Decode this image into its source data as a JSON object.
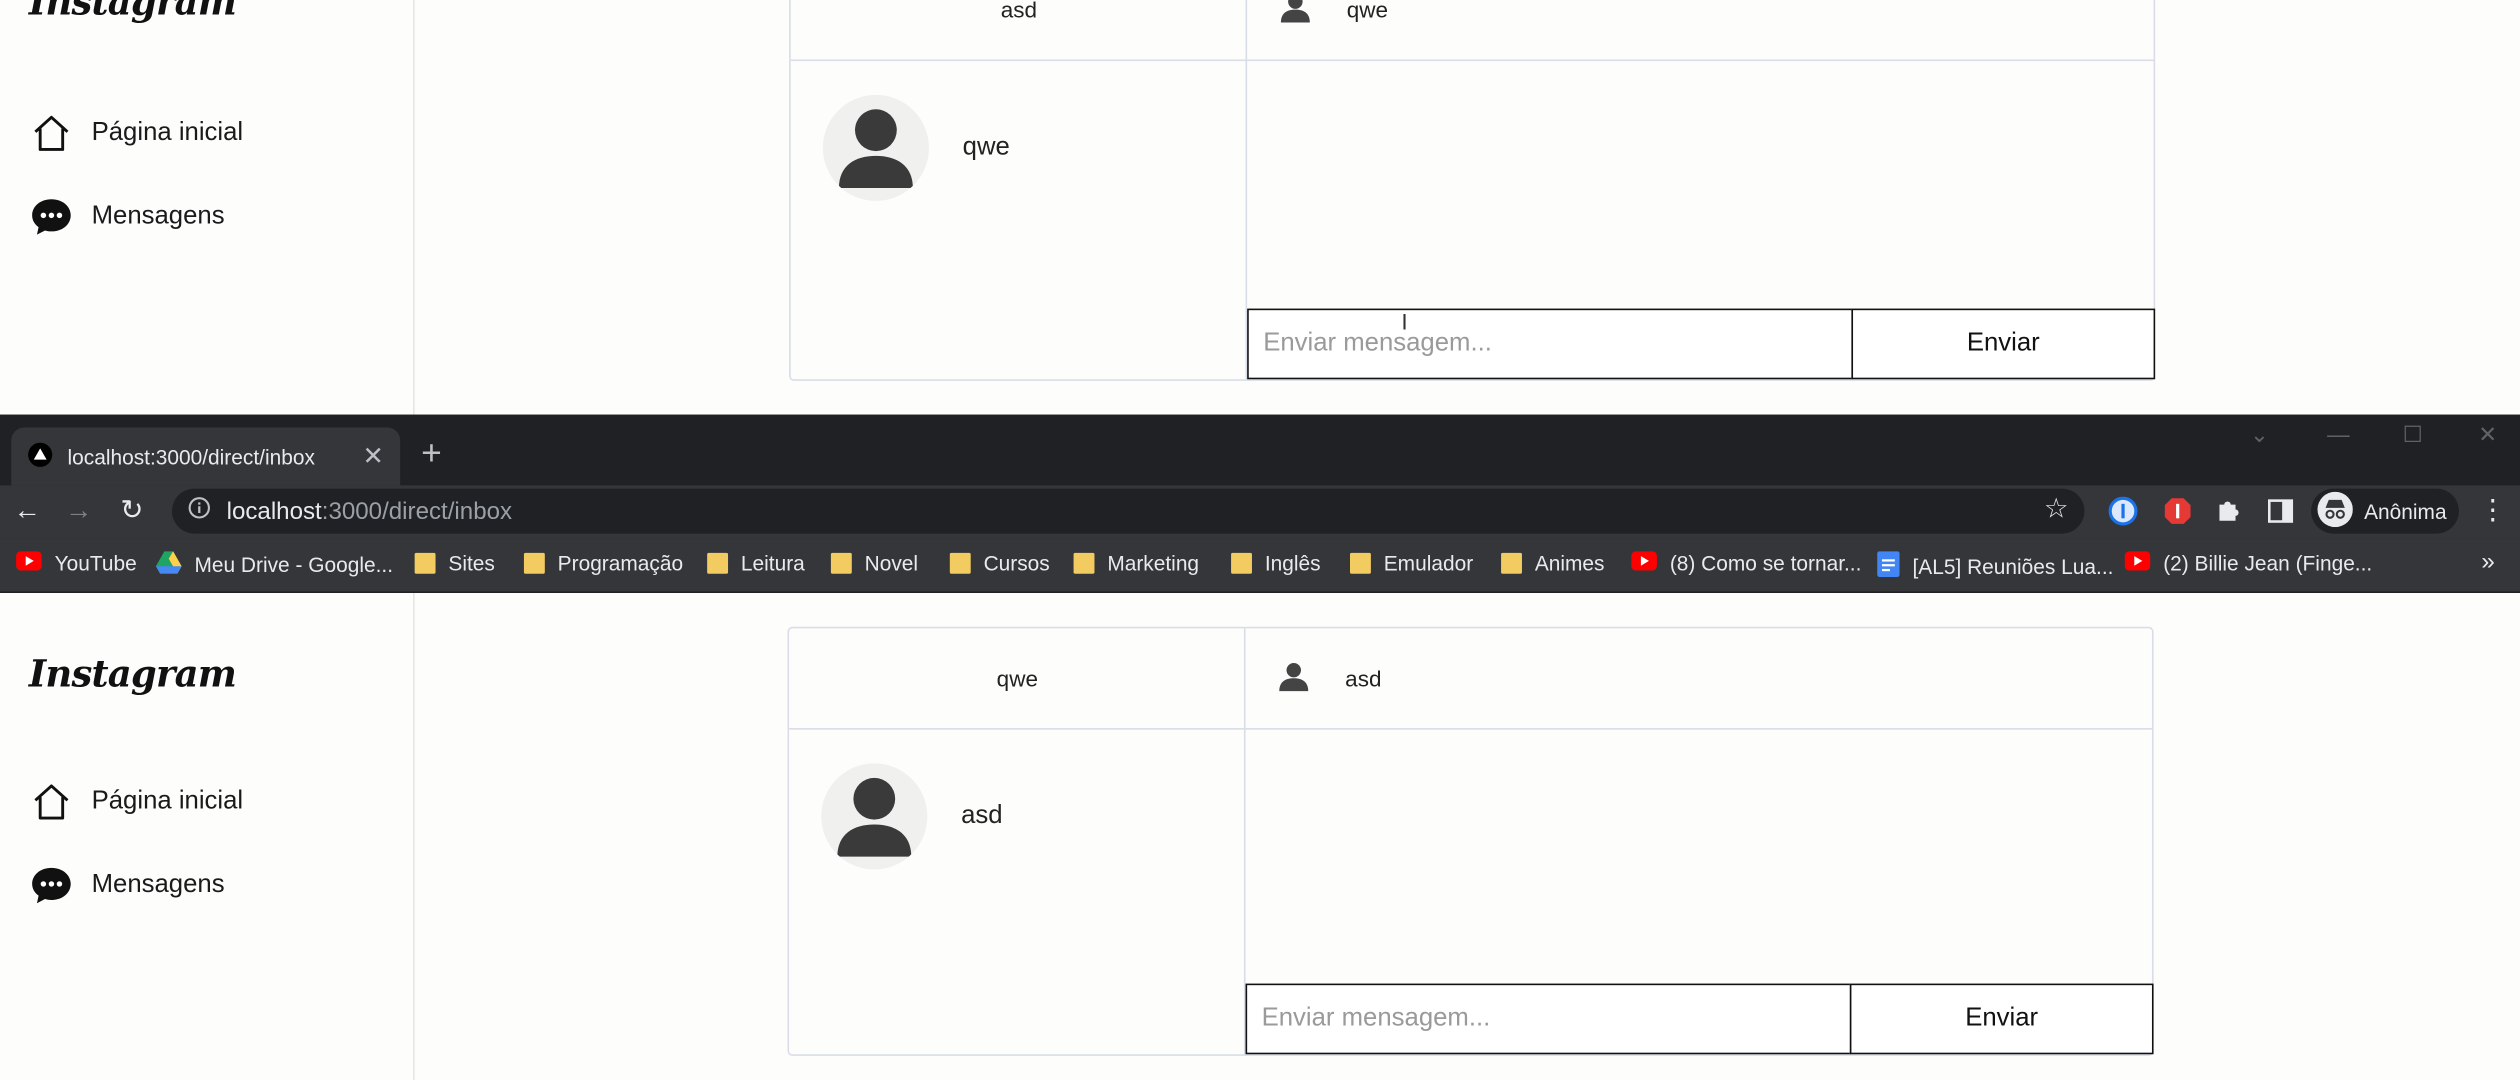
{
  "top_pane": {
    "logo": "Instagram",
    "nav": {
      "home_label": "Página inicial",
      "messages_label": "Mensagens"
    },
    "panel": {
      "left_header_name": "asd",
      "chat_header_name": "qwe",
      "conversation_name": "qwe",
      "input_placeholder": "Enviar mensagem...",
      "send_label": "Enviar"
    }
  },
  "browser": {
    "tab_title": "localhost:3000/direct/inbox",
    "url_host": "localhost",
    "url_path": ":3000/direct/inbox",
    "profile_label": "Anônima",
    "bookmarks": [
      {
        "label": "YouTube",
        "icon": "youtube-icon"
      },
      {
        "label": "Meu Drive - Google...",
        "icon": "google-drive-icon"
      },
      {
        "label": "Sites",
        "icon": "folder-icon"
      },
      {
        "label": "Programação",
        "icon": "folder-icon"
      },
      {
        "label": "Leitura",
        "icon": "folder-icon"
      },
      {
        "label": "Novel",
        "icon": "folder-icon"
      },
      {
        "label": "Cursos",
        "icon": "folder-icon"
      },
      {
        "label": "Marketing",
        "icon": "folder-icon"
      },
      {
        "label": "Inglês",
        "icon": "folder-icon"
      },
      {
        "label": "Emulador",
        "icon": "folder-icon"
      },
      {
        "label": "Animes",
        "icon": "folder-icon"
      },
      {
        "label": "(8) Como se tornar...",
        "icon": "youtube-icon"
      },
      {
        "label": "[AL5] Reuniões Lua...",
        "icon": "google-docs-icon"
      },
      {
        "label": "(2) Billie Jean (Finge...",
        "icon": "youtube-icon"
      }
    ],
    "overflow": "»"
  },
  "bottom_pane": {
    "logo": "Instagram",
    "nav": {
      "home_label": "Página inicial",
      "messages_label": "Mensagens"
    },
    "panel": {
      "left_header_name": "qwe",
      "chat_header_name": "asd",
      "conversation_name": "asd",
      "input_placeholder": "Enviar mensagem...",
      "send_label": "Enviar"
    }
  },
  "colors": {
    "page_bg": "#fdfdfb",
    "border": "#d8dde8",
    "chrome_dark": "#202124",
    "chrome_toolbar": "#35363a",
    "bookmark_folder": "#f2cc60",
    "youtube_red": "#ff0000"
  }
}
